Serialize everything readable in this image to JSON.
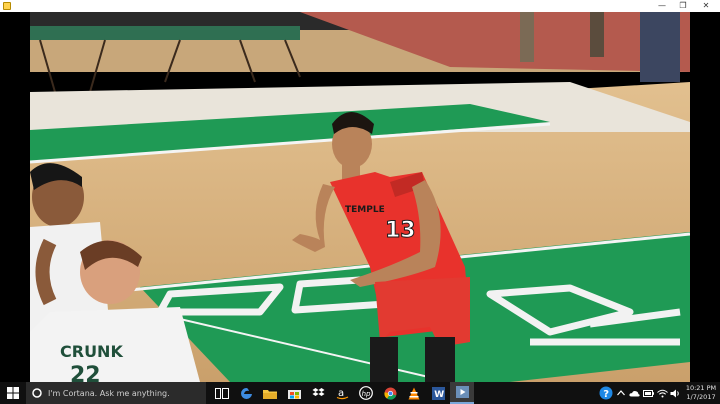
{
  "window": {
    "min_glyph": "—",
    "max_glyph": "❐",
    "close_glyph": "✕"
  },
  "video": {
    "player_number": "13",
    "jersey_text": "TEMPLE",
    "opponent_name": "CRUNK",
    "opponent_number": "22"
  },
  "taskbar": {
    "search_placeholder": "I'm Cortana. Ask me anything.",
    "time": "10:21 PM",
    "date": "1/7/2017",
    "apps": [
      "task-view",
      "edge",
      "file-explorer",
      "store",
      "dropbox",
      "amazon",
      "hp",
      "chrome",
      "vlc",
      "word",
      "video-player"
    ]
  },
  "colors": {
    "court_green": "#1f9a55",
    "floor_wood": "#d9b17e",
    "jersey_red": "#e8322c",
    "taskbar": "#101010"
  }
}
